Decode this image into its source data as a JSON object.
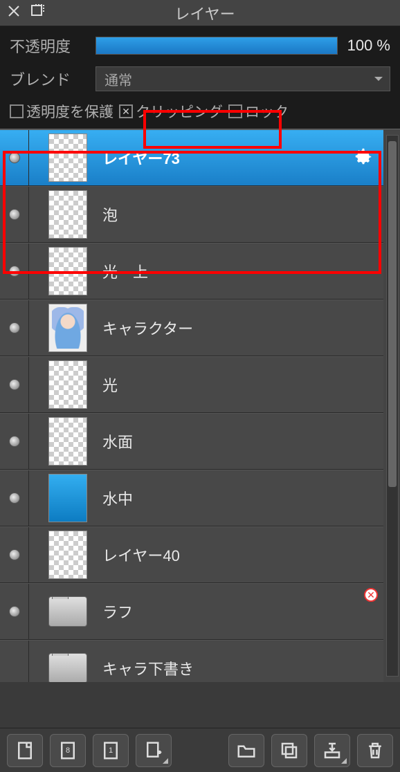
{
  "title": "レイヤー",
  "opacity": {
    "label": "不透明度",
    "value": "100 %"
  },
  "blend": {
    "label": "ブレンド",
    "value": "通常"
  },
  "checks": {
    "protect_alpha": {
      "label": "透明度を保護",
      "checked": false
    },
    "clipping": {
      "label": "クリッピング",
      "checked": true
    },
    "lock": {
      "label": "ロック",
      "checked": false
    }
  },
  "layers": [
    {
      "name": "レイヤー73",
      "selected": true,
      "thumb": "checker",
      "gear": true,
      "indent": true
    },
    {
      "name": "泡",
      "thumb": "checker"
    },
    {
      "name": "光　上",
      "thumb": "checker"
    },
    {
      "name": "キャラクター",
      "thumb": "char"
    },
    {
      "name": "光",
      "thumb": "checker"
    },
    {
      "name": "水面",
      "thumb": "checker"
    },
    {
      "name": "水中",
      "thumb": "blue"
    },
    {
      "name": "レイヤー40",
      "thumb": "checker"
    },
    {
      "name": "ラフ",
      "thumb": "folder",
      "badge": true
    },
    {
      "name": "キャラ下書き",
      "thumb": "folder",
      "hidden_vis": true
    }
  ],
  "toolbar": {
    "new_layer": "new-layer",
    "num_a": "8",
    "num_b": "1",
    "add_menu": "add",
    "folder": "folder",
    "duplicate": "duplicate",
    "merge": "merge",
    "trash": "trash"
  }
}
